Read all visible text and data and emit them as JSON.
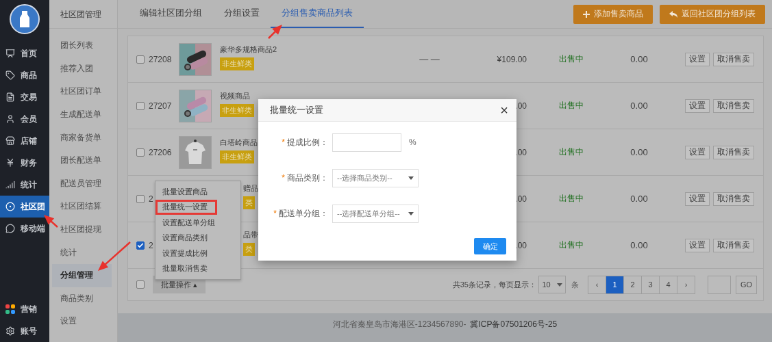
{
  "nav": {
    "items": [
      {
        "label": "首页",
        "selected": false
      },
      {
        "label": "商品",
        "selected": false
      },
      {
        "label": "交易",
        "selected": false
      },
      {
        "label": "会员",
        "selected": false
      },
      {
        "label": "店铺",
        "selected": false
      },
      {
        "label": "财务",
        "selected": false
      },
      {
        "label": "统计",
        "selected": false
      },
      {
        "label": "社区团",
        "selected": true
      },
      {
        "label": "移动端",
        "selected": false
      }
    ],
    "bottom_items": [
      {
        "label": "营销",
        "selected": false
      },
      {
        "label": "账号",
        "selected": false
      }
    ]
  },
  "subnav": {
    "title": "社区团管理",
    "items": [
      {
        "label": "团长列表",
        "selected": false
      },
      {
        "label": "推荐入团",
        "selected": false
      },
      {
        "label": "社区团订单",
        "selected": false
      },
      {
        "label": "生成配送单",
        "selected": false
      },
      {
        "label": "商家备货单",
        "selected": false
      },
      {
        "label": "团长配送单",
        "selected": false
      },
      {
        "label": "配送员管理",
        "selected": false
      },
      {
        "label": "社区团结算",
        "selected": false
      },
      {
        "label": "社区团提现",
        "selected": false
      },
      {
        "label": "统计",
        "selected": false
      },
      {
        "label": "分组管理",
        "selected": true
      },
      {
        "label": "商品类别",
        "selected": false
      },
      {
        "label": "设置",
        "selected": false
      }
    ]
  },
  "tabs": [
    {
      "label": "编辑社区团分组",
      "selected": false
    },
    {
      "label": "分组设置",
      "selected": false
    },
    {
      "label": "分组售卖商品列表",
      "selected": true
    }
  ],
  "toolbar": {
    "buttons": [
      "添加售卖商品",
      "返回社区团分组列表"
    ]
  },
  "table": {
    "rows": [
      {
        "checked": false,
        "id": "27208",
        "thumb": {
          "kind": "picture"
        },
        "name": "豪华多规格商品2",
        "tag": "非生鲜类",
        "column_5": "— —",
        "price": "¥109.00",
        "status": "出售中",
        "amount": "0.00",
        "actions": [
          "设置",
          "取消售卖"
        ]
      },
      {
        "checked": false,
        "id": "27207",
        "thumb": {
          "kind": "picture"
        },
        "name": "视频商品",
        "tag": "非生鲜类",
        "price": ".00",
        "status": "出售中",
        "amount": "0.00",
        "actions": [
          "设置",
          "取消售卖"
        ]
      },
      {
        "checked": false,
        "id": "27206",
        "thumb": {
          "kind": "picture"
        },
        "name": "白塔岭商品",
        "tag": "非生鲜类",
        "price": ".00",
        "status": "出售中",
        "amount": "0.00",
        "actions": [
          "设置",
          "取消售卖"
        ]
      },
      {
        "checked": false,
        "id": "2",
        "name": "赠品",
        "tag": "类",
        "price": ".00",
        "status": "出售中",
        "amount": "0.00",
        "actions": [
          "设置",
          "取消售卖"
        ]
      },
      {
        "checked": true,
        "id": "2",
        "name": "品带",
        "tag": "类",
        "price": ".00",
        "status": "出售中",
        "amount": "0.00",
        "actions": [
          "设置",
          "取消售卖"
        ]
      }
    ],
    "footer": {
      "select_all_checked": false,
      "batch_button": "批量操作 ▴",
      "batch_menu": [
        {
          "label": "批量设置商品",
          "highlighted": false
        },
        {
          "label": "批量统一设置",
          "highlighted": true
        },
        {
          "label": "设置配送单分组",
          "highlighted": false
        },
        {
          "label": "设置商品类别",
          "highlighted": false
        },
        {
          "label": "设置提成比例",
          "highlighted": false
        },
        {
          "label": "批量取消售卖",
          "highlighted": false
        }
      ],
      "records": "共35条记录，每页显示：",
      "page_size": "10",
      "page_size_unit": "条",
      "pages": [
        {
          "label": "‹",
          "selected": false
        },
        {
          "label": "1",
          "selected": true
        },
        {
          "label": "2",
          "selected": false
        },
        {
          "label": "3",
          "selected": false
        },
        {
          "label": "4",
          "selected": false
        },
        {
          "label": "›",
          "selected": false
        }
      ],
      "go_button": "GO"
    }
  },
  "page_footer": {
    "address": "河北省秦皇岛市海港区-1234567890-",
    "icp": "冀ICP备07501206号-25"
  },
  "dialog": {
    "title": "批量统一设置",
    "close": "×",
    "fields": [
      {
        "kind": "input",
        "required_mark": "*",
        "label": "提成比例：",
        "unit": "%"
      },
      {
        "kind": "select",
        "required_mark": "*",
        "label": "商品类别：",
        "placeholder": "--选择商品类别--"
      },
      {
        "kind": "select",
        "required_mark": "*",
        "label": "配送单分组：",
        "placeholder": "--选择配送单分组--"
      }
    ],
    "confirm": "确定"
  }
}
